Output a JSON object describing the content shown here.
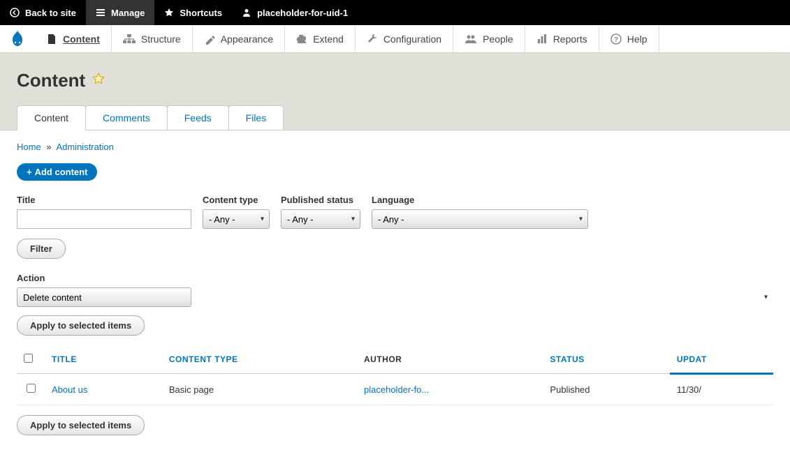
{
  "toolbar": {
    "back": "Back to site",
    "manage": "Manage",
    "shortcuts": "Shortcuts",
    "user": "placeholder-for-uid-1"
  },
  "adminMenu": {
    "content": "Content",
    "structure": "Structure",
    "appearance": "Appearance",
    "extend": "Extend",
    "configuration": "Configuration",
    "people": "People",
    "reports": "Reports",
    "help": "Help"
  },
  "pageTitle": "Content",
  "tabs": {
    "content": "Content",
    "comments": "Comments",
    "feeds": "Feeds",
    "files": "Files"
  },
  "breadcrumb": {
    "home": "Home",
    "admin": "Administration"
  },
  "addContent": "Add content",
  "filters": {
    "titleLabel": "Title",
    "contentTypeLabel": "Content type",
    "publishedStatusLabel": "Published status",
    "languageLabel": "Language",
    "anyOption": "- Any -",
    "filterButton": "Filter"
  },
  "bulkAction": {
    "label": "Action",
    "selected": "Delete content",
    "applyButton": "Apply to selected items"
  },
  "table": {
    "headers": {
      "title": "TITLE",
      "contentType": "CONTENT TYPE",
      "author": "AUTHOR",
      "status": "STATUS",
      "updated": "UPDAT"
    },
    "rows": [
      {
        "title": "About us",
        "contentType": "Basic page",
        "author": "placeholder-fo...",
        "status": "Published",
        "updated": "11/30/"
      }
    ]
  }
}
